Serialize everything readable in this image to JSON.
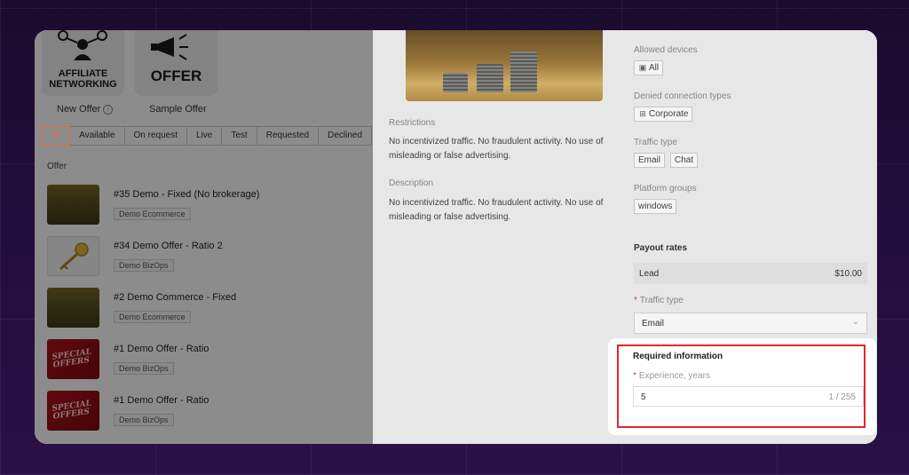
{
  "left": {
    "cards": [
      {
        "logo": "AFFILIATE NETWORKING",
        "caption": "New Offer"
      },
      {
        "logo": "OFFER",
        "caption": "Sample Offer"
      }
    ],
    "tabs": [
      "All",
      "Available",
      "On request",
      "Live",
      "Test",
      "Requested",
      "Declined"
    ],
    "section_label": "Offer",
    "offers": [
      {
        "title": "#35 Demo - Fixed (No brokerage)",
        "tag": "Demo Ecommerce",
        "thumb": "coins"
      },
      {
        "title": "#34 Demo Offer - Ratio 2",
        "tag": "Demo BizOps",
        "thumb": "key"
      },
      {
        "title": "#2 Demo Commerce - Fixed",
        "tag": "Demo Ecommerce",
        "thumb": "coins"
      },
      {
        "title": "#1 Demo Offer - Ratio",
        "tag": "Demo BizOps",
        "thumb": "special"
      },
      {
        "title": "#1 Demo Offer - Ratio",
        "tag": "Demo BizOps",
        "thumb": "special"
      }
    ],
    "special_text": "SPECIAL OFFERS"
  },
  "drawer": {
    "restrictions_label": "Restrictions",
    "restrictions_text": "No incentivized traffic. No fraudulent activity. No use of misleading or false advertising.",
    "description_label": "Description",
    "description_text": "No incentivized traffic. No fraudulent activity. No use of misleading or false advertising.",
    "allowed_devices_label": "Allowed devices",
    "allowed_devices": [
      "All"
    ],
    "denied_conn_label": "Denied connection types",
    "denied_conn": [
      "Corporate"
    ],
    "traffic_type_label": "Traffic type",
    "traffic_types": [
      "Email",
      "Chat"
    ],
    "platform_groups_label": "Platform groups",
    "platform_groups": [
      "windows"
    ],
    "payout_title": "Payout rates",
    "payout_rows": [
      {
        "label": "Lead",
        "value": "$10.00"
      }
    ],
    "traffic_select_label": "Traffic type",
    "traffic_select_value": "Email",
    "required_title": "Required information",
    "experience_label": "Experience, years",
    "experience_value": "5",
    "experience_count": "1 / 255"
  },
  "colors": {
    "accent": "#e06a4e",
    "highlight": "#e0262e",
    "background": "#1d0d33"
  }
}
